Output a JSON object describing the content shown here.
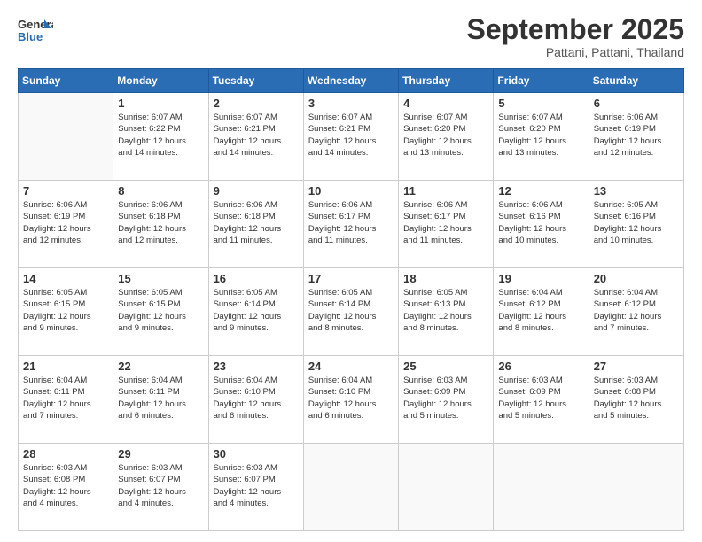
{
  "logo": {
    "general": "General",
    "blue": "Blue"
  },
  "header": {
    "month": "September 2025",
    "location": "Pattani, Pattani, Thailand"
  },
  "weekdays": [
    "Sunday",
    "Monday",
    "Tuesday",
    "Wednesday",
    "Thursday",
    "Friday",
    "Saturday"
  ],
  "weeks": [
    [
      {
        "day": "",
        "detail": ""
      },
      {
        "day": "1",
        "detail": "Sunrise: 6:07 AM\nSunset: 6:22 PM\nDaylight: 12 hours\nand 14 minutes."
      },
      {
        "day": "2",
        "detail": "Sunrise: 6:07 AM\nSunset: 6:21 PM\nDaylight: 12 hours\nand 14 minutes."
      },
      {
        "day": "3",
        "detail": "Sunrise: 6:07 AM\nSunset: 6:21 PM\nDaylight: 12 hours\nand 14 minutes."
      },
      {
        "day": "4",
        "detail": "Sunrise: 6:07 AM\nSunset: 6:20 PM\nDaylight: 12 hours\nand 13 minutes."
      },
      {
        "day": "5",
        "detail": "Sunrise: 6:07 AM\nSunset: 6:20 PM\nDaylight: 12 hours\nand 13 minutes."
      },
      {
        "day": "6",
        "detail": "Sunrise: 6:06 AM\nSunset: 6:19 PM\nDaylight: 12 hours\nand 12 minutes."
      }
    ],
    [
      {
        "day": "7",
        "detail": "Sunrise: 6:06 AM\nSunset: 6:19 PM\nDaylight: 12 hours\nand 12 minutes."
      },
      {
        "day": "8",
        "detail": "Sunrise: 6:06 AM\nSunset: 6:18 PM\nDaylight: 12 hours\nand 12 minutes."
      },
      {
        "day": "9",
        "detail": "Sunrise: 6:06 AM\nSunset: 6:18 PM\nDaylight: 12 hours\nand 11 minutes."
      },
      {
        "day": "10",
        "detail": "Sunrise: 6:06 AM\nSunset: 6:17 PM\nDaylight: 12 hours\nand 11 minutes."
      },
      {
        "day": "11",
        "detail": "Sunrise: 6:06 AM\nSunset: 6:17 PM\nDaylight: 12 hours\nand 11 minutes."
      },
      {
        "day": "12",
        "detail": "Sunrise: 6:06 AM\nSunset: 6:16 PM\nDaylight: 12 hours\nand 10 minutes."
      },
      {
        "day": "13",
        "detail": "Sunrise: 6:05 AM\nSunset: 6:16 PM\nDaylight: 12 hours\nand 10 minutes."
      }
    ],
    [
      {
        "day": "14",
        "detail": "Sunrise: 6:05 AM\nSunset: 6:15 PM\nDaylight: 12 hours\nand 9 minutes."
      },
      {
        "day": "15",
        "detail": "Sunrise: 6:05 AM\nSunset: 6:15 PM\nDaylight: 12 hours\nand 9 minutes."
      },
      {
        "day": "16",
        "detail": "Sunrise: 6:05 AM\nSunset: 6:14 PM\nDaylight: 12 hours\nand 9 minutes."
      },
      {
        "day": "17",
        "detail": "Sunrise: 6:05 AM\nSunset: 6:14 PM\nDaylight: 12 hours\nand 8 minutes."
      },
      {
        "day": "18",
        "detail": "Sunrise: 6:05 AM\nSunset: 6:13 PM\nDaylight: 12 hours\nand 8 minutes."
      },
      {
        "day": "19",
        "detail": "Sunrise: 6:04 AM\nSunset: 6:12 PM\nDaylight: 12 hours\nand 8 minutes."
      },
      {
        "day": "20",
        "detail": "Sunrise: 6:04 AM\nSunset: 6:12 PM\nDaylight: 12 hours\nand 7 minutes."
      }
    ],
    [
      {
        "day": "21",
        "detail": "Sunrise: 6:04 AM\nSunset: 6:11 PM\nDaylight: 12 hours\nand 7 minutes."
      },
      {
        "day": "22",
        "detail": "Sunrise: 6:04 AM\nSunset: 6:11 PM\nDaylight: 12 hours\nand 6 minutes."
      },
      {
        "day": "23",
        "detail": "Sunrise: 6:04 AM\nSunset: 6:10 PM\nDaylight: 12 hours\nand 6 minutes."
      },
      {
        "day": "24",
        "detail": "Sunrise: 6:04 AM\nSunset: 6:10 PM\nDaylight: 12 hours\nand 6 minutes."
      },
      {
        "day": "25",
        "detail": "Sunrise: 6:03 AM\nSunset: 6:09 PM\nDaylight: 12 hours\nand 5 minutes."
      },
      {
        "day": "26",
        "detail": "Sunrise: 6:03 AM\nSunset: 6:09 PM\nDaylight: 12 hours\nand 5 minutes."
      },
      {
        "day": "27",
        "detail": "Sunrise: 6:03 AM\nSunset: 6:08 PM\nDaylight: 12 hours\nand 5 minutes."
      }
    ],
    [
      {
        "day": "28",
        "detail": "Sunrise: 6:03 AM\nSunset: 6:08 PM\nDaylight: 12 hours\nand 4 minutes."
      },
      {
        "day": "29",
        "detail": "Sunrise: 6:03 AM\nSunset: 6:07 PM\nDaylight: 12 hours\nand 4 minutes."
      },
      {
        "day": "30",
        "detail": "Sunrise: 6:03 AM\nSunset: 6:07 PM\nDaylight: 12 hours\nand 4 minutes."
      },
      {
        "day": "",
        "detail": ""
      },
      {
        "day": "",
        "detail": ""
      },
      {
        "day": "",
        "detail": ""
      },
      {
        "day": "",
        "detail": ""
      }
    ]
  ]
}
